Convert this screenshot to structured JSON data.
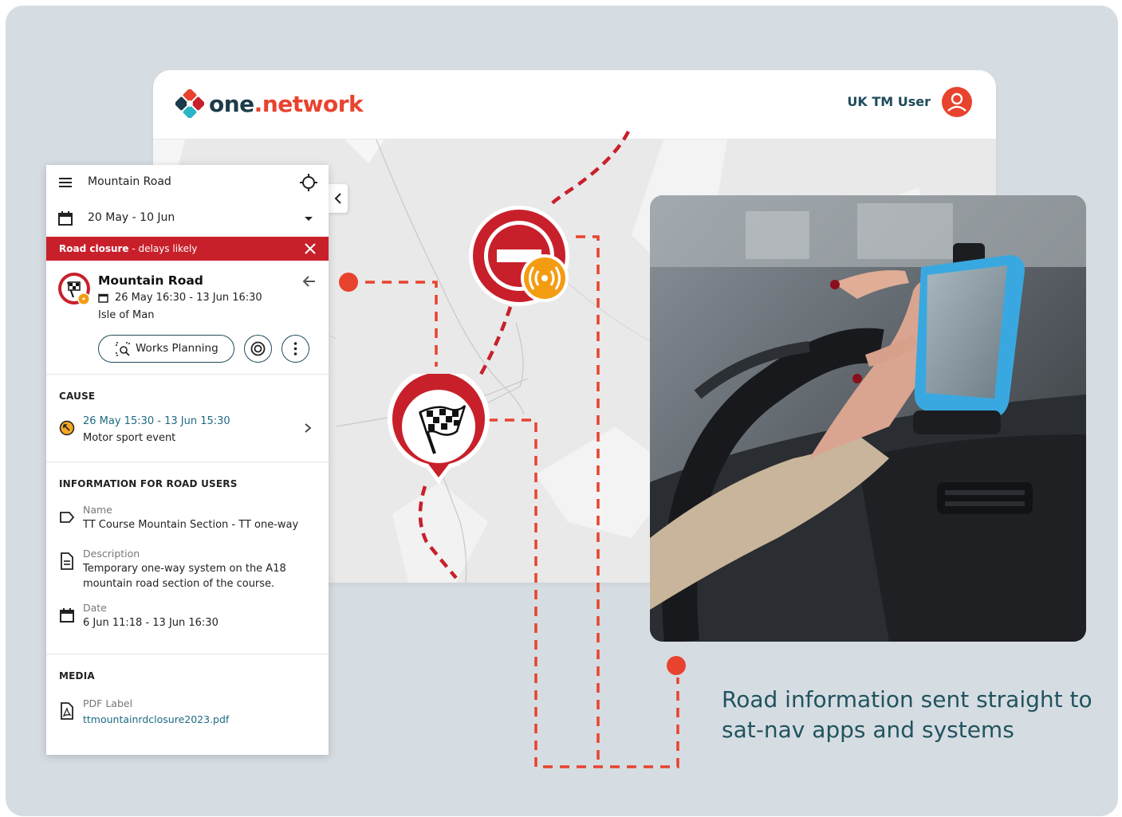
{
  "brand": {
    "logo_one": "one",
    "logo_dot": ".",
    "logo_network": "network"
  },
  "header": {
    "user_name": "UK TM User"
  },
  "panel": {
    "search_value": "Mountain Road",
    "date_range": "20 May - 10 Jun",
    "alert": {
      "strong": "Road closure",
      "rest": " - delays likely"
    },
    "event": {
      "title": "Mountain Road",
      "dates": "26 May 16:30 - 13 Jun 16:30",
      "location": "Isle of Man",
      "works_planning_label": "Works Planning"
    },
    "cause": {
      "heading": "CAUSE",
      "dates": "26 May 15:30 - 13 Jun 15:30",
      "type": "Motor sport event"
    },
    "info": {
      "heading": "INFORMATION FOR ROAD USERS",
      "name_label": "Name",
      "name_value": "TT Course Mountain Section - TT one-way",
      "desc_label": "Description",
      "desc_line1": "Temporary one-way system on the A18",
      "desc_line2": "mountain road section of the course.",
      "date_label": "Date",
      "date_value": "6 Jun 11:18 - 13 Jun 16:30"
    },
    "media": {
      "heading": "MEDIA",
      "label": "PDF Label",
      "file": "ttmountainrdclosure2023.pdf"
    }
  },
  "caption": {
    "line1": "Road information sent straight to",
    "line2": "sat-nav apps and systems"
  },
  "colors": {
    "accent_red": "#e8432e",
    "closure_red": "#c8202b",
    "teal": "#1d6a84",
    "navy": "#1f4b5a",
    "alert_orange": "#f39c12"
  },
  "icons": [
    "menu-icon",
    "crosshair-icon",
    "calendar-icon",
    "chevron-down-icon",
    "close-icon",
    "arrow-left-icon",
    "chevron-right-icon",
    "tag-icon",
    "document-icon",
    "pdf-icon",
    "user-icon",
    "no-entry-icon",
    "broadcast-icon",
    "checkered-flag-icon",
    "chevron-left-icon",
    "target-icon",
    "more-vertical-icon",
    "search-area-icon",
    "cause-icon"
  ]
}
